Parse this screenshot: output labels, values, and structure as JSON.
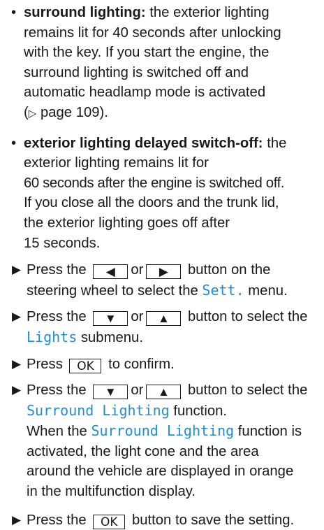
{
  "bullets": [
    {
      "marker": "•",
      "term": "surround lighting:",
      "lines": [
        "the exterior lighting",
        "remains lit for 40 seconds after unlocking",
        "with the key. If you start the engine, the",
        "surround lighting is switched off and",
        "automatic headlamp mode is activated"
      ],
      "ref_open": "(",
      "ref_icon": "▷",
      "ref_text": " page 109)."
    },
    {
      "marker": "•",
      "term": "exterior lighting delayed switch-off:",
      "lines": [
        "the",
        "exterior lighting remains lit for",
        "60 seconds after the engine is switched off.",
        "If you close all the doors and the trunk lid,",
        "the exterior lighting goes off after",
        "15 seconds."
      ]
    }
  ],
  "steps": {
    "arrow": "▶",
    "s1": {
      "a": "Press the",
      "key1": "◀",
      "or": "or",
      "key2": "▶",
      "b": "button on the",
      "c": "steering wheel to select the",
      "menu": "Sett.",
      "d": "menu."
    },
    "s2": {
      "a": "Press the",
      "key1": "▼",
      "or": "or",
      "key2": "▲",
      "b": "button to select the",
      "menu": "Lights",
      "c": "submenu."
    },
    "s3": {
      "a": "Press",
      "key": "OK",
      "b": "to confirm."
    },
    "s4": {
      "a": "Press the",
      "key1": "▼",
      "or": "or",
      "key2": "▲",
      "b": "button to select the",
      "func": "Surround Lighting",
      "c": "function.",
      "d": "When the",
      "func2": "Surround Lighting",
      "e": "function is",
      "f": "activated, the light cone and the area",
      "g": "around the vehicle are displayed in orange",
      "h": "in the multifunction display."
    },
    "s5": {
      "a": "Press the",
      "key": "OK",
      "b": "button to save the setting."
    }
  },
  "colors": {
    "display_text": "#1f8fd1",
    "body_text": "#1a1a1a"
  }
}
